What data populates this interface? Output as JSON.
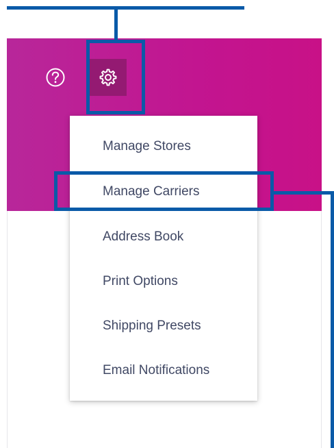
{
  "colors": {
    "header_gradient_start": "#b8279a",
    "header_gradient_end": "#c81187",
    "settings_active_bg": "#941a72",
    "menu_text": "#404864",
    "annotation_blue": "#0a5aa8"
  },
  "header": {
    "help_icon": "question-circle-icon",
    "settings_icon": "gear-icon"
  },
  "settings_menu": {
    "items": [
      {
        "label": "Manage Stores"
      },
      {
        "label": "Manage Carriers",
        "highlighted": true
      },
      {
        "label": "Address Book"
      },
      {
        "label": "Print Options"
      },
      {
        "label": "Shipping Presets"
      },
      {
        "label": "Email Notifications"
      }
    ]
  }
}
